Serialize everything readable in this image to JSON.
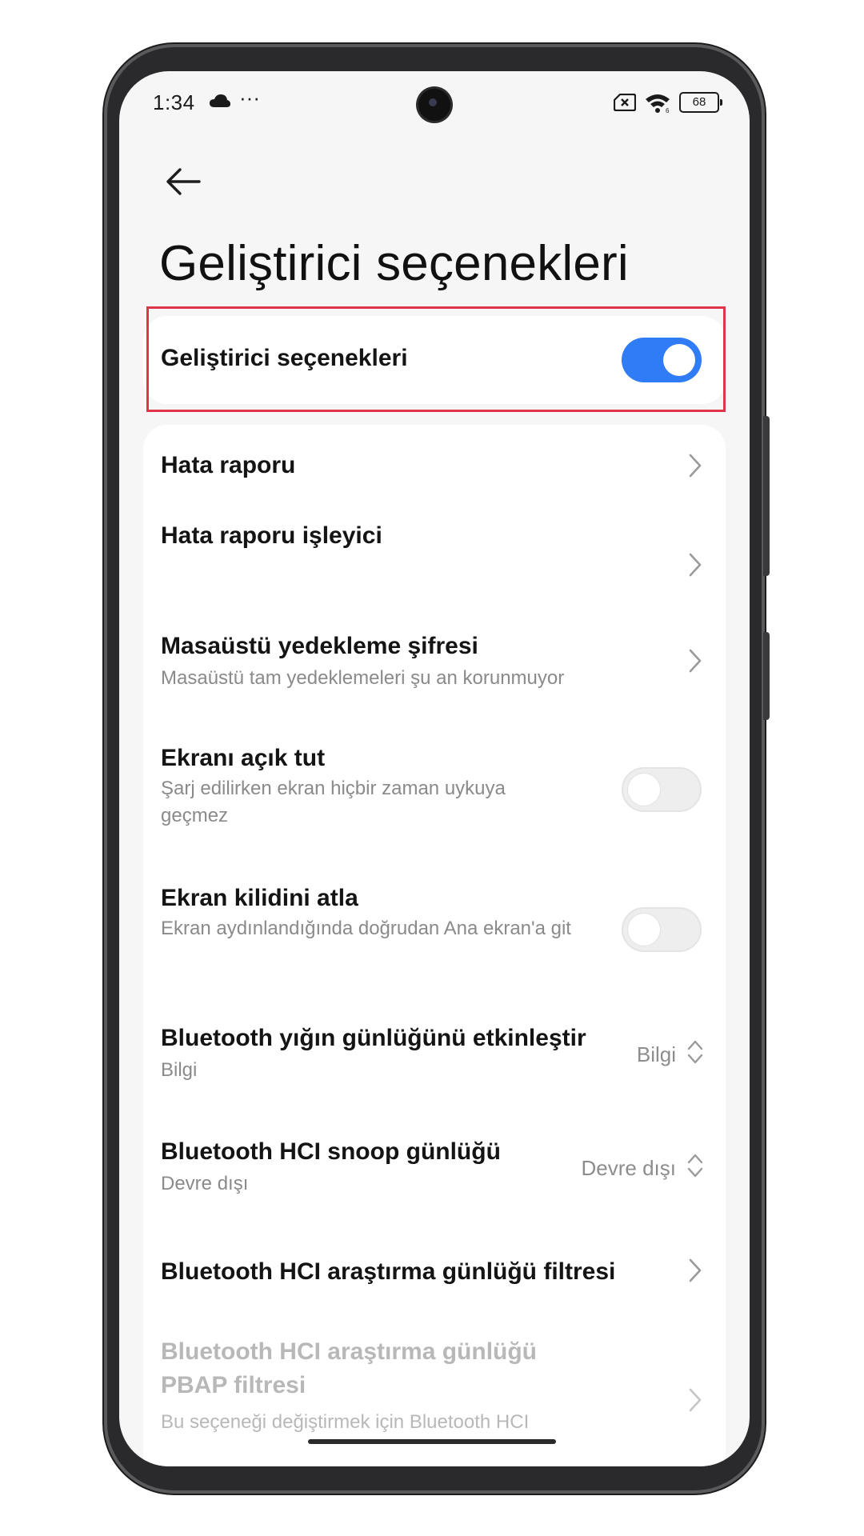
{
  "status_bar": {
    "time": "1:34",
    "more": "···",
    "battery": "68"
  },
  "header": {
    "title": "Geliştirici seçenekleri"
  },
  "master_toggle": {
    "label": "Geliştirici seçenekleri",
    "state": "on"
  },
  "settings": {
    "bug_report": {
      "title": "Hata raporu"
    },
    "bug_report_handler": {
      "title": "Hata raporu işleyici"
    },
    "desktop_backup": {
      "title": "Masaüstü yedekleme şifresi",
      "subtitle": "Masaüstü tam yedeklemeleri şu an korunmuyor"
    },
    "stay_awake": {
      "title": "Ekranı açık tut",
      "subtitle": "Şarj edilirken ekran hiçbir zaman uykuya geçmez",
      "state": "off"
    },
    "skip_lock": {
      "title": "Ekran kilidini atla",
      "subtitle": "Ekran aydınlandığında doğrudan Ana ekran'a git",
      "state": "off"
    },
    "bt_stack_log": {
      "title": "Bluetooth yığın günlüğünü etkinleştir",
      "subtitle": "Bilgi",
      "value": "Bilgi"
    },
    "bt_hci_snoop": {
      "title": "Bluetooth HCI snoop günlüğü",
      "subtitle": "Devre dışı",
      "value": "Devre dışı"
    },
    "bt_hci_filter": {
      "title": "Bluetooth HCI araştırma günlüğü filtresi"
    },
    "bt_hci_pbap": {
      "title": "Bluetooth HCI araştırma günlüğü PBAP filtresi",
      "subtitle": "Bu seçeneği değiştirmek için Bluetooth HCI"
    }
  },
  "colors": {
    "accent": "#2f7cf6",
    "highlight_border": "#e0344a",
    "background": "#f6f6f6"
  }
}
